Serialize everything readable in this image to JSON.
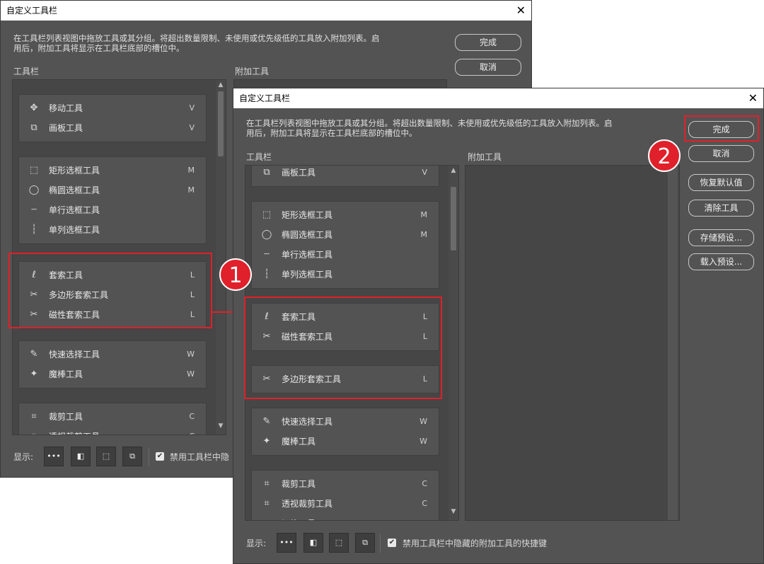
{
  "back_dialog": {
    "title": "自定义工具栏",
    "description_line1": "在工具栏列表视图中拖放工具或其分组。将超出数量限制、未使用或优先级低的工具放入附加列表。启",
    "description_line2": "用后，附加工具将显示在工具栏底部的槽位中。",
    "done_label": "完成",
    "cancel_label": "取消",
    "toolbar_label": "工具栏",
    "extra_label": "附加工具",
    "show_label": "显示:",
    "checkbox_label": "禁用工具栏中隐",
    "groups": [
      [
        {
          "icon": "✥",
          "name": "移动工具",
          "key": "V"
        },
        {
          "icon": "⧉",
          "name": "画板工具",
          "key": "V"
        }
      ],
      [
        {
          "icon": "⬚",
          "name": "矩形选框工具",
          "key": "M"
        },
        {
          "icon": "◯",
          "name": "椭圆选框工具",
          "key": "M"
        },
        {
          "icon": "┄",
          "name": "单行选框工具",
          "key": ""
        },
        {
          "icon": "┆",
          "name": "单列选框工具",
          "key": ""
        }
      ],
      [
        {
          "icon": "ℓ",
          "name": "套索工具",
          "key": "L"
        },
        {
          "icon": "✂",
          "name": "多边形套索工具",
          "key": "L"
        },
        {
          "icon": "✂",
          "name": "磁性套索工具",
          "key": "L"
        }
      ],
      [
        {
          "icon": "✎",
          "name": "快速选择工具",
          "key": "W"
        },
        {
          "icon": "✦",
          "name": "魔棒工具",
          "key": "W"
        }
      ],
      [
        {
          "icon": "⌗",
          "name": "裁剪工具",
          "key": "C"
        },
        {
          "icon": "⌗",
          "name": "透视裁剪工具",
          "key": "C"
        }
      ]
    ]
  },
  "front_dialog": {
    "title": "自定义工具栏",
    "description_line1": "在工具栏列表视图中拖放工具或其分组。将超出数量限制、未使用或优先级低的工具放入附加列表。启",
    "description_line2": "用后，附加工具将显示在工具栏底部的槽位中。",
    "done_label": "完成",
    "cancel_label": "取消",
    "restore_label": "恢复默认值",
    "clear_label": "清除工具",
    "save_preset_label": "存储预设...",
    "load_preset_label": "载入预设...",
    "toolbar_label": "工具栏",
    "extra_label": "附加工具",
    "show_label": "显示:",
    "checkbox_label": "禁用工具栏中隐藏的附加工具的快捷键",
    "groups": [
      [
        {
          "icon": "⧉",
          "name": "画板工具",
          "key": "V"
        }
      ],
      [
        {
          "icon": "⬚",
          "name": "矩形选框工具",
          "key": "M"
        },
        {
          "icon": "◯",
          "name": "椭圆选框工具",
          "key": "M"
        },
        {
          "icon": "┄",
          "name": "单行选框工具",
          "key": ""
        },
        {
          "icon": "┆",
          "name": "单列选框工具",
          "key": ""
        }
      ],
      [
        {
          "icon": "ℓ",
          "name": "套索工具",
          "key": "L"
        },
        {
          "icon": "✂",
          "name": "磁性套索工具",
          "key": "L"
        }
      ],
      [
        {
          "icon": "✂",
          "name": "多边形套索工具",
          "key": "L"
        }
      ],
      [
        {
          "icon": "✎",
          "name": "快速选择工具",
          "key": "W"
        },
        {
          "icon": "✦",
          "name": "魔棒工具",
          "key": "W"
        }
      ],
      [
        {
          "icon": "⌗",
          "name": "裁剪工具",
          "key": "C"
        },
        {
          "icon": "⌗",
          "name": "透视裁剪工具",
          "key": "C"
        },
        {
          "icon": "⌗",
          "name": "切片工具",
          "key": "C"
        }
      ]
    ]
  },
  "show_buttons": [
    "•••",
    "◧",
    "⬚",
    "⧉"
  ],
  "checkbox_mark": "✔",
  "annotations": {
    "badge1": "1",
    "badge2": "2"
  },
  "colors": {
    "highlight": "#e0202a",
    "panel": "#535353",
    "list_bg": "#464646"
  }
}
